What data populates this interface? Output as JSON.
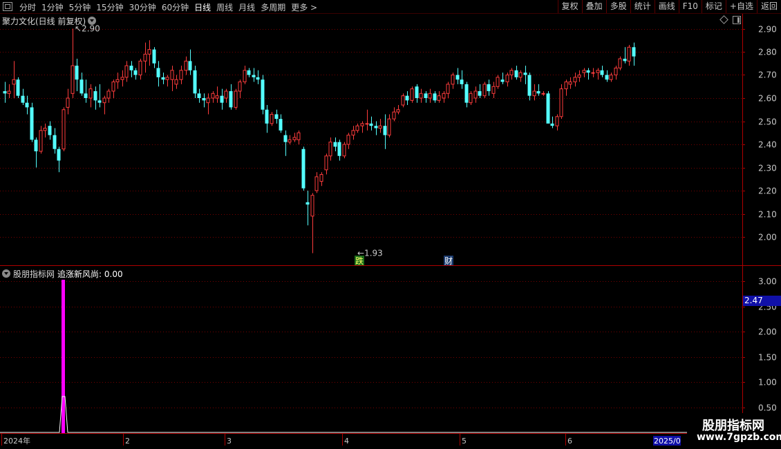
{
  "toolbar": {
    "periods": [
      "分时",
      "1分钟",
      "5分钟",
      "15分钟",
      "30分钟",
      "60分钟",
      "日线",
      "周线",
      "月线",
      "多周期",
      "更多"
    ],
    "active_period": "日线",
    "more_arrow": ">",
    "actions": [
      "复权",
      "叠加",
      "多股",
      "统计",
      "画线",
      "F10",
      "标记",
      "+自选",
      "返回"
    ]
  },
  "main_chart": {
    "title": "聚力文化(日线 前复权)",
    "price_axis": [
      "2.90",
      "2.80",
      "2.70",
      "2.60",
      "2.50",
      "2.40",
      "2.30",
      "2.20",
      "2.10",
      "2.00"
    ],
    "high_label": "2.90",
    "low_label": "1.93",
    "marker_die": "跌",
    "marker_cai": "财"
  },
  "sub_chart": {
    "title": "股朋指标网",
    "line_label": "追涨新风尚:",
    "line_value": "0.00",
    "axis": [
      "3.00",
      "2.50",
      "2.00",
      "1.50",
      "1.00",
      "0.50"
    ],
    "current_price_tag": "2.47"
  },
  "date_axis": {
    "labels": [
      "2024年",
      "2",
      "3",
      "4",
      "5",
      "6"
    ],
    "end_label": "2025/0"
  },
  "watermark": {
    "line1": "股朋指标网",
    "line2": "www.7gpzb.com"
  },
  "colors": {
    "up": "#ff3c3c",
    "down": "#54ffff",
    "grid": "#8b0000",
    "signal": "#ff00ff"
  },
  "chart_data": {
    "type": "candlestick",
    "y_range": [
      1.9,
      2.92
    ],
    "candles": [
      [
        2.63,
        2.67,
        2.58,
        2.62
      ],
      [
        2.62,
        2.66,
        2.6,
        2.63
      ],
      [
        2.66,
        2.76,
        2.6,
        2.68
      ],
      [
        2.68,
        2.69,
        2.6,
        2.61
      ],
      [
        2.61,
        2.64,
        2.57,
        2.58
      ],
      [
        2.58,
        2.61,
        2.53,
        2.56
      ],
      [
        2.56,
        2.58,
        2.41,
        2.42
      ],
      [
        2.42,
        2.43,
        2.3,
        2.37
      ],
      [
        2.37,
        2.48,
        2.36,
        2.46
      ],
      [
        2.46,
        2.49,
        2.43,
        2.47
      ],
      [
        2.48,
        2.5,
        2.42,
        2.44
      ],
      [
        2.44,
        2.47,
        2.36,
        2.38
      ],
      [
        2.38,
        2.39,
        2.28,
        2.33
      ],
      [
        2.38,
        2.56,
        2.37,
        2.55
      ],
      [
        2.56,
        2.64,
        2.53,
        2.6
      ],
      [
        2.62,
        2.9,
        2.6,
        2.74
      ],
      [
        2.74,
        2.77,
        2.63,
        2.68
      ],
      [
        2.68,
        2.71,
        2.61,
        2.62
      ],
      [
        2.62,
        2.68,
        2.58,
        2.6
      ],
      [
        2.6,
        2.66,
        2.56,
        2.64
      ],
      [
        2.63,
        2.65,
        2.55,
        2.59
      ],
      [
        2.59,
        2.66,
        2.56,
        2.58
      ],
      [
        2.58,
        2.61,
        2.53,
        2.6
      ],
      [
        2.6,
        2.64,
        2.58,
        2.63
      ],
      [
        2.63,
        2.68,
        2.6,
        2.67
      ],
      [
        2.67,
        2.71,
        2.64,
        2.68
      ],
      [
        2.68,
        2.72,
        2.65,
        2.69
      ],
      [
        2.69,
        2.76,
        2.67,
        2.74
      ],
      [
        2.74,
        2.76,
        2.69,
        2.72
      ],
      [
        2.72,
        2.73,
        2.68,
        2.7
      ],
      [
        2.7,
        2.77,
        2.68,
        2.76
      ],
      [
        2.76,
        2.84,
        2.71,
        2.79
      ],
      [
        2.79,
        2.85,
        2.74,
        2.81
      ],
      [
        2.81,
        2.82,
        2.73,
        2.75
      ],
      [
        2.73,
        2.76,
        2.65,
        2.69
      ],
      [
        2.69,
        2.71,
        2.66,
        2.68
      ],
      [
        2.68,
        2.7,
        2.65,
        2.69
      ],
      [
        2.68,
        2.74,
        2.63,
        2.72
      ],
      [
        2.66,
        2.7,
        2.64,
        2.68
      ],
      [
        2.68,
        2.74,
        2.66,
        2.72
      ],
      [
        2.72,
        2.78,
        2.7,
        2.76
      ],
      [
        2.76,
        2.81,
        2.7,
        2.72
      ],
      [
        2.72,
        2.74,
        2.6,
        2.62
      ],
      [
        2.62,
        2.64,
        2.58,
        2.6
      ],
      [
        2.6,
        2.62,
        2.56,
        2.59
      ],
      [
        2.58,
        2.62,
        2.53,
        2.6
      ],
      [
        2.6,
        2.63,
        2.58,
        2.62
      ],
      [
        2.6,
        2.65,
        2.58,
        2.61
      ],
      [
        2.61,
        2.64,
        2.55,
        2.58
      ],
      [
        2.6,
        2.64,
        2.58,
        2.63
      ],
      [
        2.63,
        2.66,
        2.55,
        2.56
      ],
      [
        2.56,
        2.64,
        2.55,
        2.63
      ],
      [
        2.63,
        2.68,
        2.6,
        2.67
      ],
      [
        2.67,
        2.74,
        2.66,
        2.72
      ],
      [
        2.72,
        2.73,
        2.69,
        2.7
      ],
      [
        2.7,
        2.73,
        2.67,
        2.69
      ],
      [
        2.69,
        2.72,
        2.66,
        2.68
      ],
      [
        2.68,
        2.7,
        2.53,
        2.55
      ],
      [
        2.55,
        2.57,
        2.45,
        2.49
      ],
      [
        2.49,
        2.54,
        2.48,
        2.53
      ],
      [
        2.53,
        2.55,
        2.49,
        2.51
      ],
      [
        2.51,
        2.53,
        2.45,
        2.46
      ],
      [
        2.44,
        2.46,
        2.35,
        2.41
      ],
      [
        2.41,
        2.44,
        2.4,
        2.42
      ],
      [
        2.42,
        2.45,
        2.41,
        2.43
      ],
      [
        2.42,
        2.46,
        2.4,
        2.45
      ],
      [
        2.38,
        2.39,
        2.2,
        2.21
      ],
      [
        2.15,
        2.2,
        2.05,
        2.14
      ],
      [
        2.09,
        2.19,
        1.93,
        2.18
      ],
      [
        2.2,
        2.28,
        2.19,
        2.26
      ],
      [
        2.24,
        2.28,
        2.22,
        2.27
      ],
      [
        2.29,
        2.36,
        2.27,
        2.35
      ],
      [
        2.35,
        2.43,
        2.33,
        2.41
      ],
      [
        2.41,
        2.43,
        2.37,
        2.39
      ],
      [
        2.41,
        2.42,
        2.33,
        2.35
      ],
      [
        2.35,
        2.41,
        2.34,
        2.4
      ],
      [
        2.4,
        2.45,
        2.38,
        2.44
      ],
      [
        2.44,
        2.48,
        2.42,
        2.46
      ],
      [
        2.46,
        2.49,
        2.45,
        2.48
      ],
      [
        2.48,
        2.5,
        2.45,
        2.49
      ],
      [
        2.49,
        2.55,
        2.46,
        2.49
      ],
      [
        2.49,
        2.52,
        2.46,
        2.48
      ],
      [
        2.48,
        2.5,
        2.44,
        2.47
      ],
      [
        2.47,
        2.51,
        2.45,
        2.48
      ],
      [
        2.48,
        2.53,
        2.38,
        2.44
      ],
      [
        2.44,
        2.53,
        2.43,
        2.51
      ],
      [
        2.51,
        2.56,
        2.5,
        2.54
      ],
      [
        2.54,
        2.57,
        2.53,
        2.55
      ],
      [
        2.57,
        2.62,
        2.56,
        2.61
      ],
      [
        2.61,
        2.63,
        2.57,
        2.59
      ],
      [
        2.59,
        2.65,
        2.58,
        2.64
      ],
      [
        2.65,
        2.66,
        2.58,
        2.6
      ],
      [
        2.6,
        2.64,
        2.58,
        2.62
      ],
      [
        2.62,
        2.63,
        2.58,
        2.6
      ],
      [
        2.6,
        2.64,
        2.58,
        2.62
      ],
      [
        2.62,
        2.63,
        2.58,
        2.59
      ],
      [
        2.59,
        2.63,
        2.58,
        2.61
      ],
      [
        2.6,
        2.63,
        2.58,
        2.62
      ],
      [
        2.62,
        2.67,
        2.6,
        2.66
      ],
      [
        2.66,
        2.71,
        2.64,
        2.7
      ],
      [
        2.7,
        2.73,
        2.66,
        2.68
      ],
      [
        2.68,
        2.72,
        2.64,
        2.66
      ],
      [
        2.66,
        2.67,
        2.56,
        2.58
      ],
      [
        2.58,
        2.63,
        2.57,
        2.62
      ],
      [
        2.6,
        2.65,
        2.58,
        2.63
      ],
      [
        2.63,
        2.66,
        2.6,
        2.61
      ],
      [
        2.61,
        2.67,
        2.6,
        2.66
      ],
      [
        2.66,
        2.68,
        2.61,
        2.63
      ],
      [
        2.62,
        2.67,
        2.6,
        2.65
      ],
      [
        2.65,
        2.7,
        2.64,
        2.69
      ],
      [
        2.68,
        2.71,
        2.66,
        2.67
      ],
      [
        2.67,
        2.71,
        2.65,
        2.7
      ],
      [
        2.7,
        2.73,
        2.68,
        2.72
      ],
      [
        2.72,
        2.74,
        2.68,
        2.69
      ],
      [
        2.69,
        2.72,
        2.67,
        2.71
      ],
      [
        2.71,
        2.74,
        2.66,
        2.7
      ],
      [
        2.7,
        2.71,
        2.59,
        2.61
      ],
      [
        2.61,
        2.66,
        2.59,
        2.63
      ],
      [
        2.63,
        2.66,
        2.61,
        2.62
      ],
      [
        2.62,
        2.63,
        2.61,
        2.62
      ],
      [
        2.62,
        2.63,
        2.52,
        2.49
      ],
      [
        2.49,
        2.52,
        2.47,
        2.48
      ],
      [
        2.48,
        2.53,
        2.46,
        2.52
      ],
      [
        2.52,
        2.66,
        2.51,
        2.64
      ],
      [
        2.64,
        2.68,
        2.61,
        2.67
      ],
      [
        2.66,
        2.69,
        2.64,
        2.67
      ],
      [
        2.67,
        2.71,
        2.65,
        2.69
      ],
      [
        2.69,
        2.72,
        2.67,
        2.7
      ],
      [
        2.71,
        2.73,
        2.69,
        2.72
      ],
      [
        2.72,
        2.73,
        2.68,
        2.71
      ],
      [
        2.71,
        2.73,
        2.69,
        2.71
      ],
      [
        2.71,
        2.73,
        2.68,
        2.72
      ],
      [
        2.72,
        2.74,
        2.69,
        2.7
      ],
      [
        2.7,
        2.72,
        2.67,
        2.68
      ],
      [
        2.68,
        2.71,
        2.67,
        2.7
      ],
      [
        2.7,
        2.74,
        2.68,
        2.73
      ],
      [
        2.73,
        2.78,
        2.72,
        2.77
      ],
      [
        2.77,
        2.82,
        2.75,
        2.76
      ],
      [
        2.76,
        2.83,
        2.74,
        2.82
      ],
      [
        2.82,
        2.84,
        2.74,
        2.78
      ]
    ],
    "signal": {
      "index": 13,
      "value": 3.0
    }
  }
}
